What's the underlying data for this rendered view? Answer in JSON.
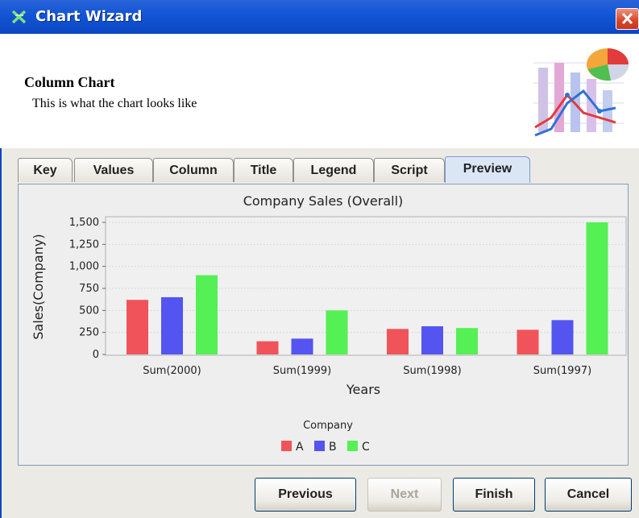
{
  "window": {
    "title": "Chart Wizard"
  },
  "header": {
    "title": "Column Chart",
    "subtitle": "This is what the chart looks like"
  },
  "tabs": [
    {
      "label": "Key"
    },
    {
      "label": "Values"
    },
    {
      "label": "Column"
    },
    {
      "label": "Title"
    },
    {
      "label": "Legend"
    },
    {
      "label": "Script"
    },
    {
      "label": "Preview",
      "active": true
    }
  ],
  "buttons": {
    "previous": "Previous",
    "next": "Next",
    "finish": "Finish",
    "cancel": "Cancel"
  },
  "chart_data": {
    "type": "bar",
    "title": "Company Sales (Overall)",
    "xlabel": "Years",
    "ylabel": "Sales(Company)",
    "categories": [
      "Sum(2000)",
      "Sum(1999)",
      "Sum(1998)",
      "Sum(1997)"
    ],
    "series": [
      {
        "name": "A",
        "color": "#f0545a",
        "values": [
          620,
          150,
          290,
          280
        ]
      },
      {
        "name": "B",
        "color": "#5454f0",
        "values": [
          650,
          180,
          320,
          390
        ]
      },
      {
        "name": "C",
        "color": "#54f054",
        "values": [
          900,
          500,
          300,
          1500
        ]
      }
    ],
    "ylim": [
      0,
      1500
    ],
    "yticks": [
      "0",
      "250",
      "500",
      "750",
      "1,000",
      "1,250",
      "1,500"
    ],
    "legend_title": "Company",
    "legend_position": "bottom",
    "grid": true
  }
}
